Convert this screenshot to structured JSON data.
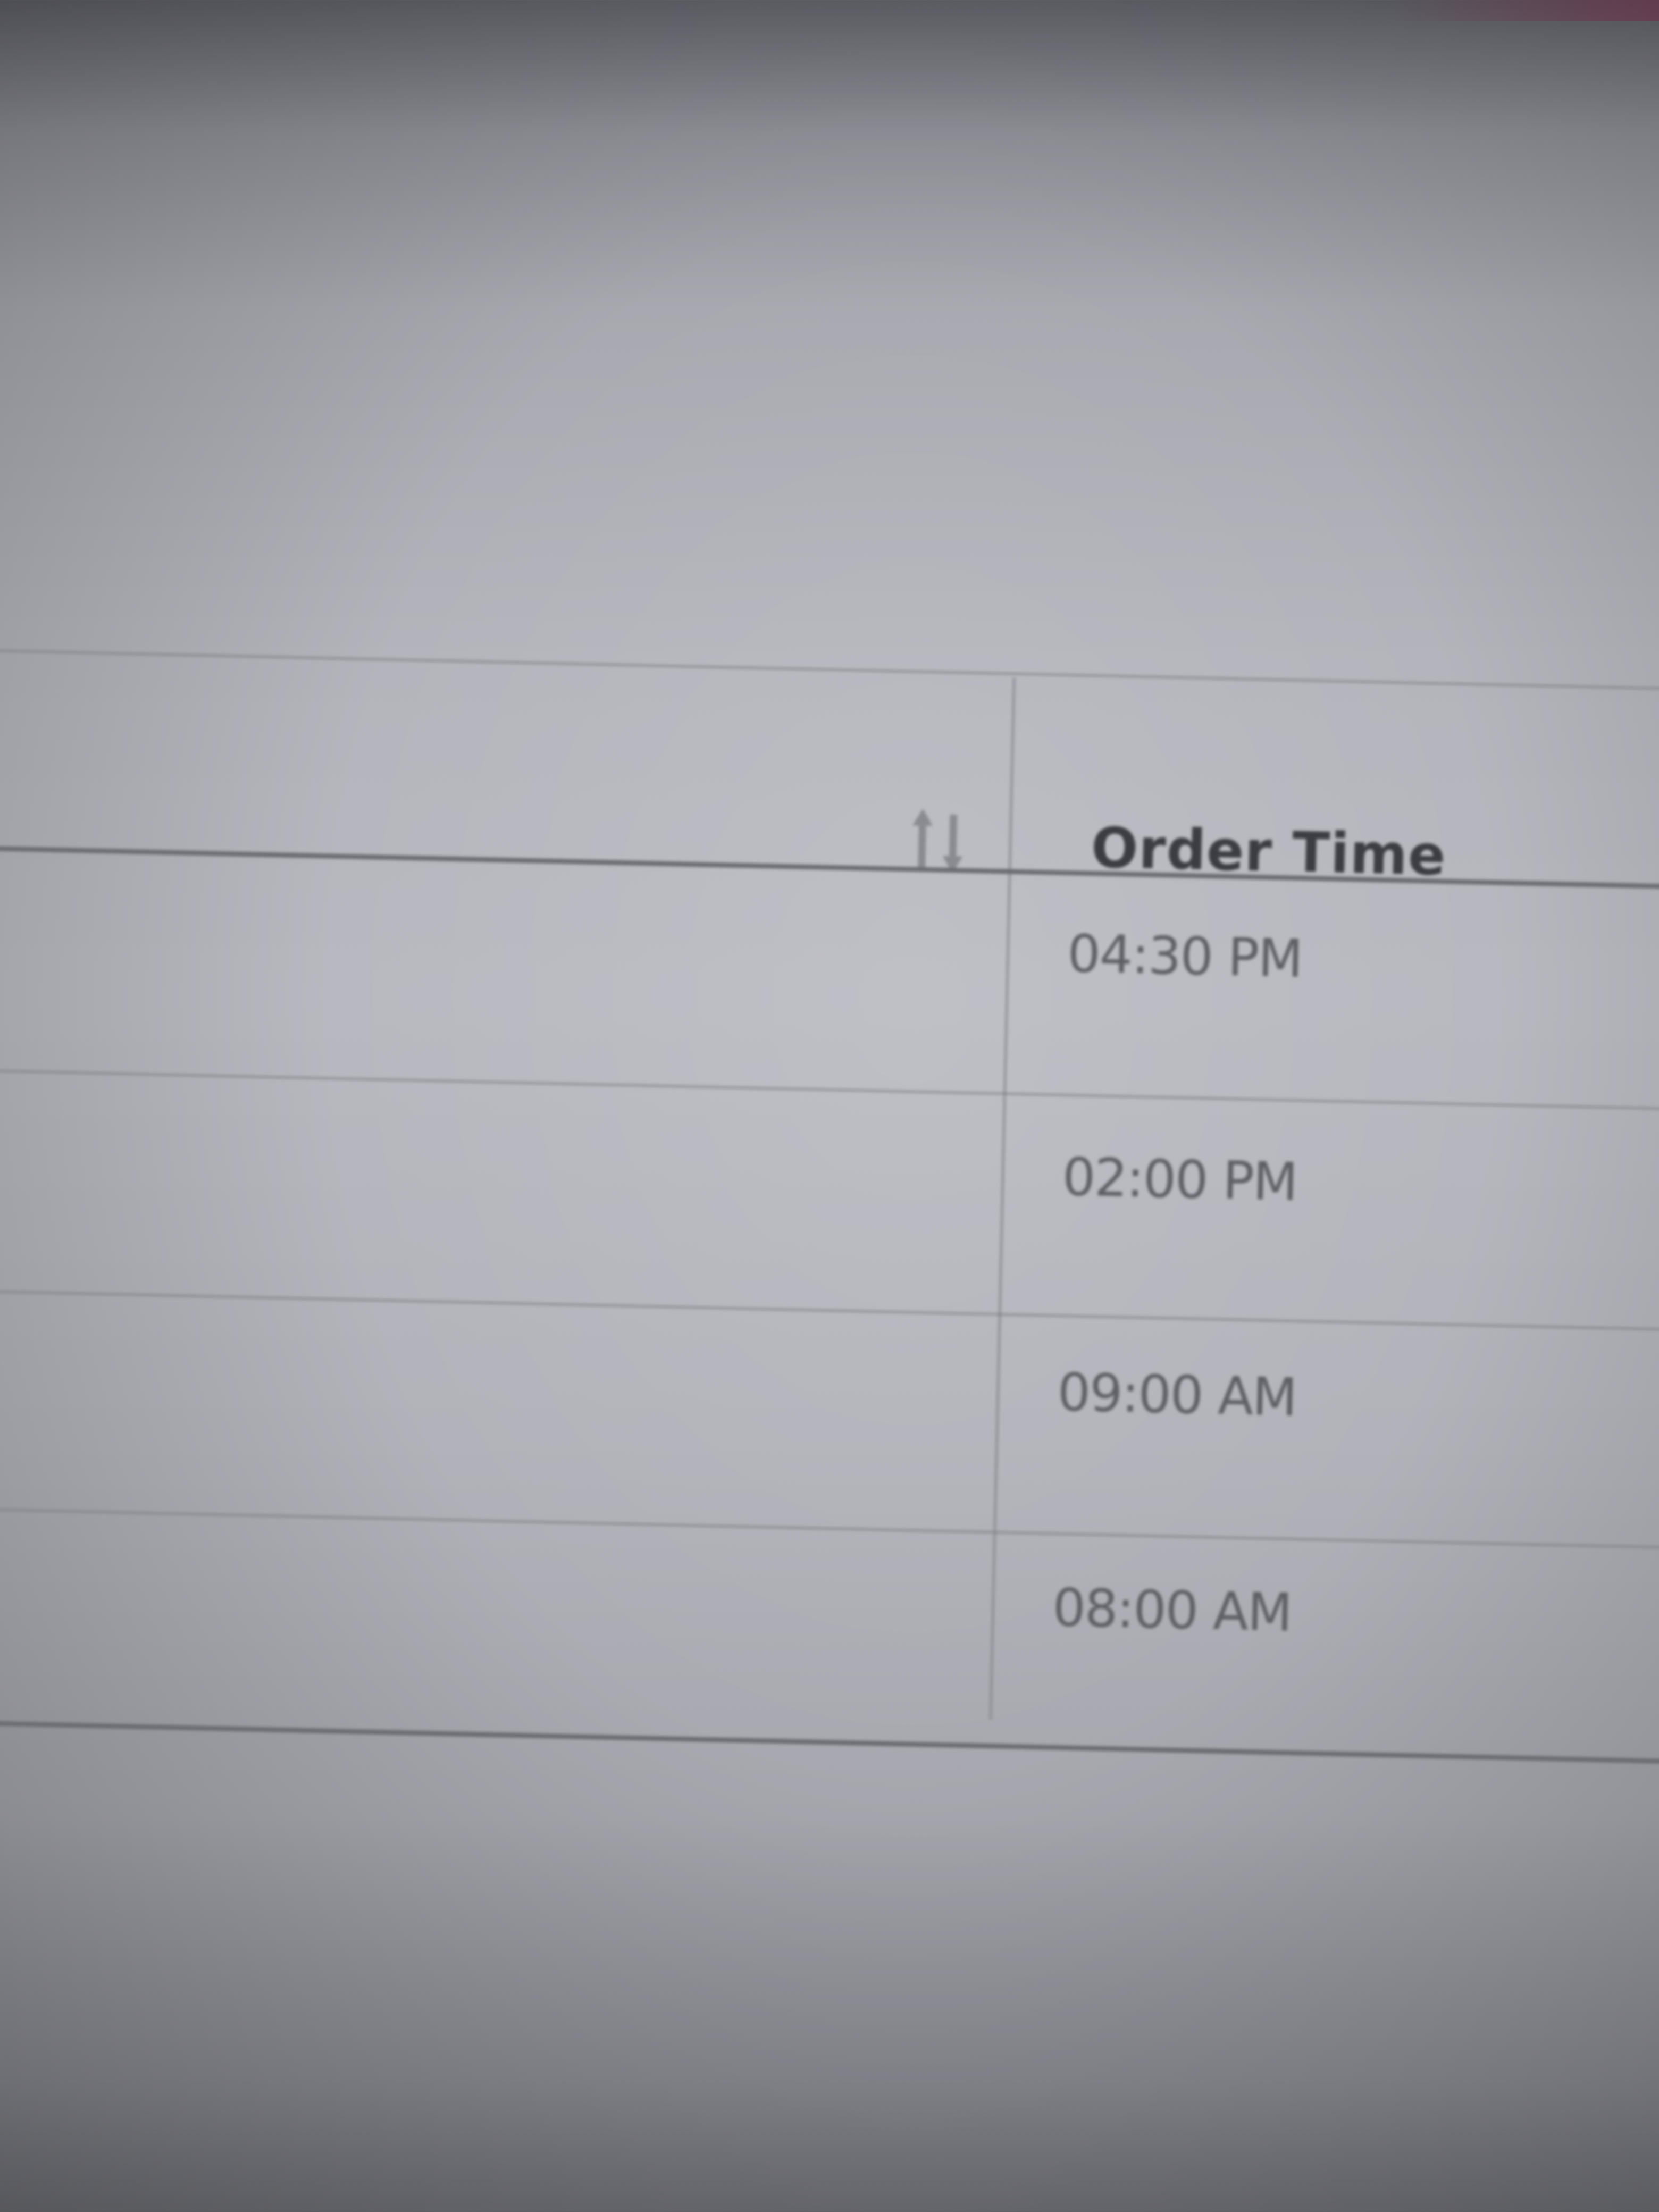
{
  "table": {
    "columns": [
      {
        "label": "",
        "sort_icon": "sort-arrows-icon"
      },
      {
        "label": "Order Time"
      }
    ],
    "rows": [
      {
        "order_time": "04:30 PM"
      },
      {
        "order_time": "02:00 PM"
      },
      {
        "order_time": "09:00 AM"
      },
      {
        "order_time": "08:00 AM"
      }
    ]
  }
}
